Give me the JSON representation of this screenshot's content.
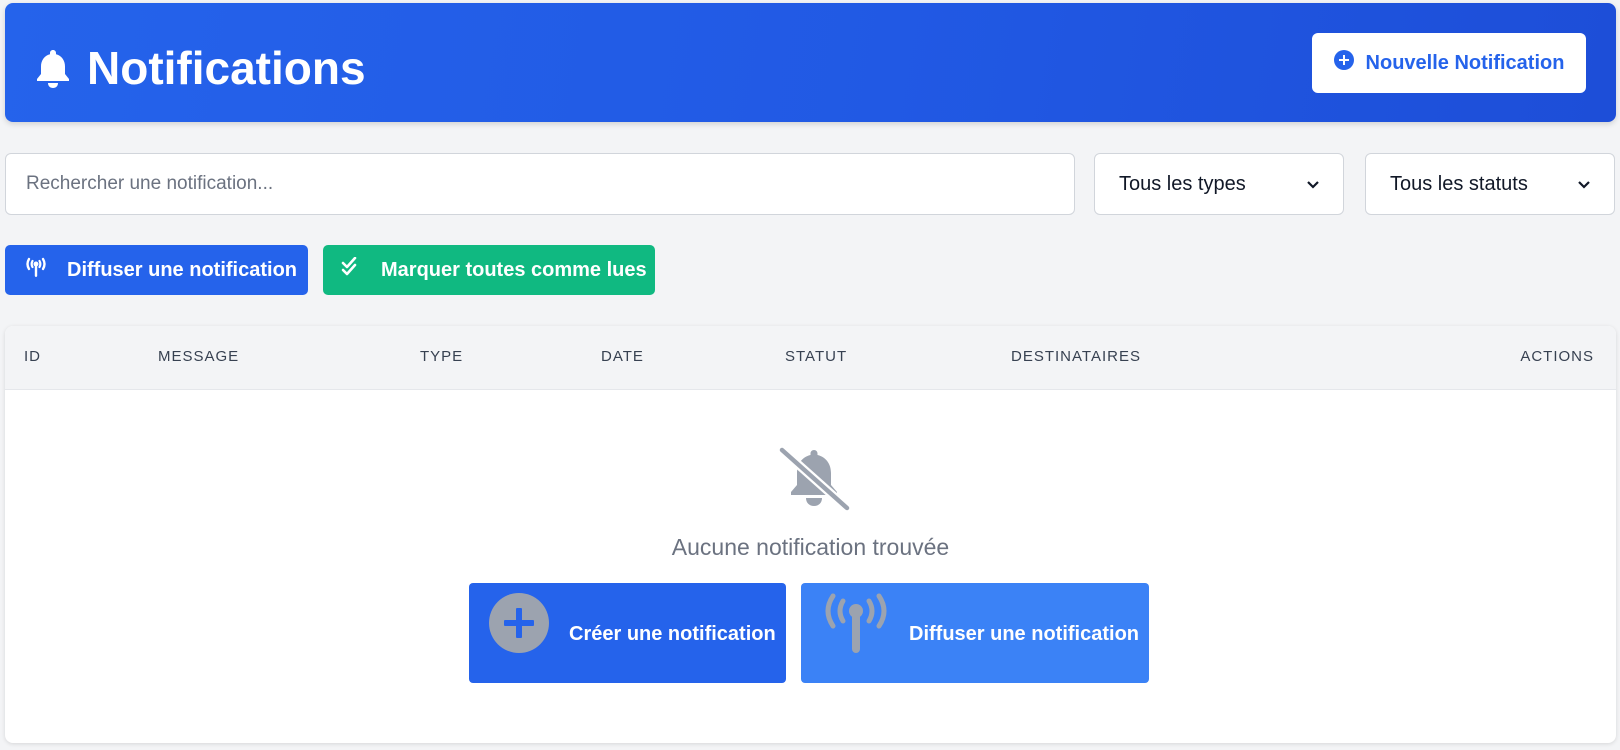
{
  "header": {
    "title": "Notifications",
    "new_button": "Nouvelle Notification"
  },
  "filters": {
    "search_placeholder": "Rechercher une notification...",
    "type_select": "Tous les types",
    "status_select": "Tous les statuts"
  },
  "actions": {
    "broadcast": "Diffuser une notification",
    "mark_all_read": "Marquer toutes comme lues"
  },
  "table": {
    "columns": [
      "ID",
      "MESSAGE",
      "TYPE",
      "DATE",
      "STATUT",
      "DESTINATAIRES",
      "ACTIONS"
    ],
    "rows": []
  },
  "empty_state": {
    "message": "Aucune notification trouvée",
    "create_button": "Créer une notification",
    "broadcast_button": "Diffuser une notification"
  },
  "colors": {
    "primary": "#2563eb",
    "success": "#10b981",
    "light_blue": "#3b82f6",
    "muted_icon": "#9ca3af"
  }
}
